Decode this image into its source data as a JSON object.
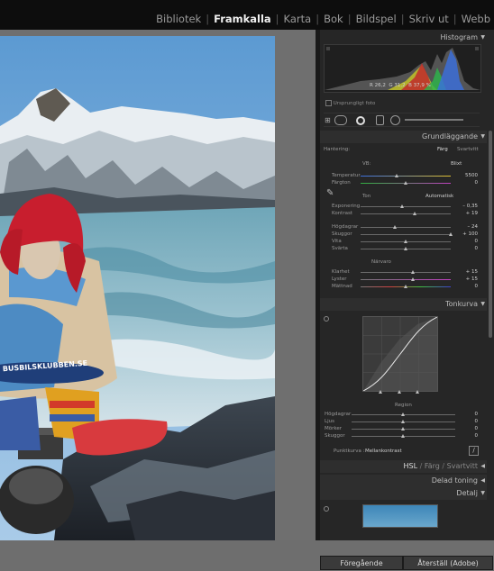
{
  "modules": [
    "Bibliotek",
    "Framkalla",
    "Karta",
    "Bok",
    "Bildspel",
    "Skriv ut",
    "Webb"
  ],
  "active_module": "Framkalla",
  "histogram": {
    "title": "Histogram",
    "r_label": "R",
    "r_value": "26,2",
    "g_label": "G",
    "g_value": "31,2",
    "b_label": "B",
    "b_value": "37,9 %",
    "original_photo": "Ursprungligt foto"
  },
  "basic": {
    "title": "Grundläggande",
    "treatment_label": "Hantering:",
    "color": "Färg",
    "bw": "Svartvitt",
    "wb_label": "VB:",
    "wb_value": "Blixt",
    "temp_label": "Temperatur",
    "temp_value": "5500",
    "tint_label": "Färgton",
    "tint_value": "0",
    "tone_label": "Ton",
    "auto": "Automatisk",
    "exposure_label": "Exponering",
    "exposure_value": "– 0,35",
    "contrast_label": "Kontrast",
    "contrast_value": "+ 19",
    "highlights_label": "Högdagrar",
    "highlights_value": "– 24",
    "shadows_label": "Skuggor",
    "shadows_value": "+ 100",
    "whites_label": "Vita",
    "whites_value": "0",
    "blacks_label": "Svärta",
    "blacks_value": "0",
    "presence_label": "Närvaro",
    "clarity_label": "Klarhet",
    "clarity_value": "+ 15",
    "vibrance_label": "Lyster",
    "vibrance_value": "+ 15",
    "saturation_label": "Mättnad",
    "saturation_value": "0"
  },
  "tonecurve": {
    "title": "Tonkurva",
    "region_label": "Region",
    "highlights_label": "Högdagrar",
    "highlights_value": "0",
    "lights_label": "Ljus",
    "lights_value": "0",
    "darks_label": "Mörker",
    "darks_value": "0",
    "shadows_label": "Skuggor",
    "shadows_value": "0",
    "point_curve_label": "Punktkurva :",
    "point_curve_value": "Mellankontrast"
  },
  "hsl": {
    "hsl": "HSL",
    "color": "Färg",
    "bw": "Svartvitt"
  },
  "split_toning": "Delad toning",
  "detail": "Detalj",
  "buttons": {
    "previous": "Föregående",
    "reset": "Återställ (Adobe)"
  },
  "photo": {
    "badge_text": "BUSBILSKLUBBEN.SE"
  },
  "colors": {
    "panel_bg": "#262626",
    "topbar_bg": "#0d0d0d",
    "accent": "#f0f0f0"
  }
}
